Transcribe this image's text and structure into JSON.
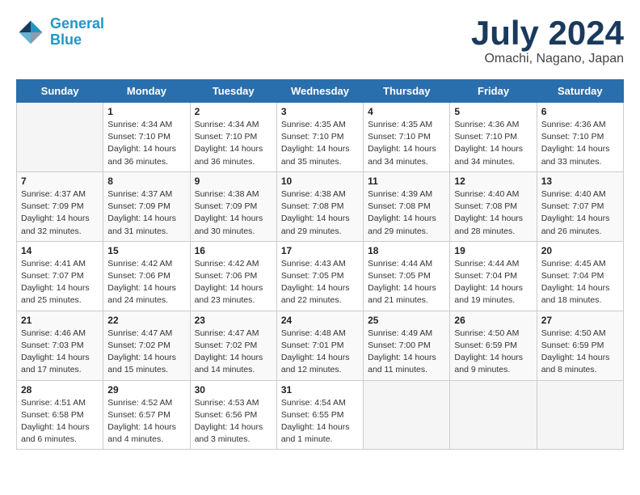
{
  "logo": {
    "line1": "General",
    "line2": "Blue"
  },
  "title": "July 2024",
  "location": "Omachi, Nagano, Japan",
  "days_of_week": [
    "Sunday",
    "Monday",
    "Tuesday",
    "Wednesday",
    "Thursday",
    "Friday",
    "Saturday"
  ],
  "weeks": [
    [
      {
        "day": "",
        "info": ""
      },
      {
        "day": "1",
        "info": "Sunrise: 4:34 AM\nSunset: 7:10 PM\nDaylight: 14 hours\nand 36 minutes."
      },
      {
        "day": "2",
        "info": "Sunrise: 4:34 AM\nSunset: 7:10 PM\nDaylight: 14 hours\nand 36 minutes."
      },
      {
        "day": "3",
        "info": "Sunrise: 4:35 AM\nSunset: 7:10 PM\nDaylight: 14 hours\nand 35 minutes."
      },
      {
        "day": "4",
        "info": "Sunrise: 4:35 AM\nSunset: 7:10 PM\nDaylight: 14 hours\nand 34 minutes."
      },
      {
        "day": "5",
        "info": "Sunrise: 4:36 AM\nSunset: 7:10 PM\nDaylight: 14 hours\nand 34 minutes."
      },
      {
        "day": "6",
        "info": "Sunrise: 4:36 AM\nSunset: 7:10 PM\nDaylight: 14 hours\nand 33 minutes."
      }
    ],
    [
      {
        "day": "7",
        "info": "Sunrise: 4:37 AM\nSunset: 7:09 PM\nDaylight: 14 hours\nand 32 minutes."
      },
      {
        "day": "8",
        "info": "Sunrise: 4:37 AM\nSunset: 7:09 PM\nDaylight: 14 hours\nand 31 minutes."
      },
      {
        "day": "9",
        "info": "Sunrise: 4:38 AM\nSunset: 7:09 PM\nDaylight: 14 hours\nand 30 minutes."
      },
      {
        "day": "10",
        "info": "Sunrise: 4:38 AM\nSunset: 7:08 PM\nDaylight: 14 hours\nand 29 minutes."
      },
      {
        "day": "11",
        "info": "Sunrise: 4:39 AM\nSunset: 7:08 PM\nDaylight: 14 hours\nand 29 minutes."
      },
      {
        "day": "12",
        "info": "Sunrise: 4:40 AM\nSunset: 7:08 PM\nDaylight: 14 hours\nand 28 minutes."
      },
      {
        "day": "13",
        "info": "Sunrise: 4:40 AM\nSunset: 7:07 PM\nDaylight: 14 hours\nand 26 minutes."
      }
    ],
    [
      {
        "day": "14",
        "info": "Sunrise: 4:41 AM\nSunset: 7:07 PM\nDaylight: 14 hours\nand 25 minutes."
      },
      {
        "day": "15",
        "info": "Sunrise: 4:42 AM\nSunset: 7:06 PM\nDaylight: 14 hours\nand 24 minutes."
      },
      {
        "day": "16",
        "info": "Sunrise: 4:42 AM\nSunset: 7:06 PM\nDaylight: 14 hours\nand 23 minutes."
      },
      {
        "day": "17",
        "info": "Sunrise: 4:43 AM\nSunset: 7:05 PM\nDaylight: 14 hours\nand 22 minutes."
      },
      {
        "day": "18",
        "info": "Sunrise: 4:44 AM\nSunset: 7:05 PM\nDaylight: 14 hours\nand 21 minutes."
      },
      {
        "day": "19",
        "info": "Sunrise: 4:44 AM\nSunset: 7:04 PM\nDaylight: 14 hours\nand 19 minutes."
      },
      {
        "day": "20",
        "info": "Sunrise: 4:45 AM\nSunset: 7:04 PM\nDaylight: 14 hours\nand 18 minutes."
      }
    ],
    [
      {
        "day": "21",
        "info": "Sunrise: 4:46 AM\nSunset: 7:03 PM\nDaylight: 14 hours\nand 17 minutes."
      },
      {
        "day": "22",
        "info": "Sunrise: 4:47 AM\nSunset: 7:02 PM\nDaylight: 14 hours\nand 15 minutes."
      },
      {
        "day": "23",
        "info": "Sunrise: 4:47 AM\nSunset: 7:02 PM\nDaylight: 14 hours\nand 14 minutes."
      },
      {
        "day": "24",
        "info": "Sunrise: 4:48 AM\nSunset: 7:01 PM\nDaylight: 14 hours\nand 12 minutes."
      },
      {
        "day": "25",
        "info": "Sunrise: 4:49 AM\nSunset: 7:00 PM\nDaylight: 14 hours\nand 11 minutes."
      },
      {
        "day": "26",
        "info": "Sunrise: 4:50 AM\nSunset: 6:59 PM\nDaylight: 14 hours\nand 9 minutes."
      },
      {
        "day": "27",
        "info": "Sunrise: 4:50 AM\nSunset: 6:59 PM\nDaylight: 14 hours\nand 8 minutes."
      }
    ],
    [
      {
        "day": "28",
        "info": "Sunrise: 4:51 AM\nSunset: 6:58 PM\nDaylight: 14 hours\nand 6 minutes."
      },
      {
        "day": "29",
        "info": "Sunrise: 4:52 AM\nSunset: 6:57 PM\nDaylight: 14 hours\nand 4 minutes."
      },
      {
        "day": "30",
        "info": "Sunrise: 4:53 AM\nSunset: 6:56 PM\nDaylight: 14 hours\nand 3 minutes."
      },
      {
        "day": "31",
        "info": "Sunrise: 4:54 AM\nSunset: 6:55 PM\nDaylight: 14 hours\nand 1 minute."
      },
      {
        "day": "",
        "info": ""
      },
      {
        "day": "",
        "info": ""
      },
      {
        "day": "",
        "info": ""
      }
    ]
  ]
}
